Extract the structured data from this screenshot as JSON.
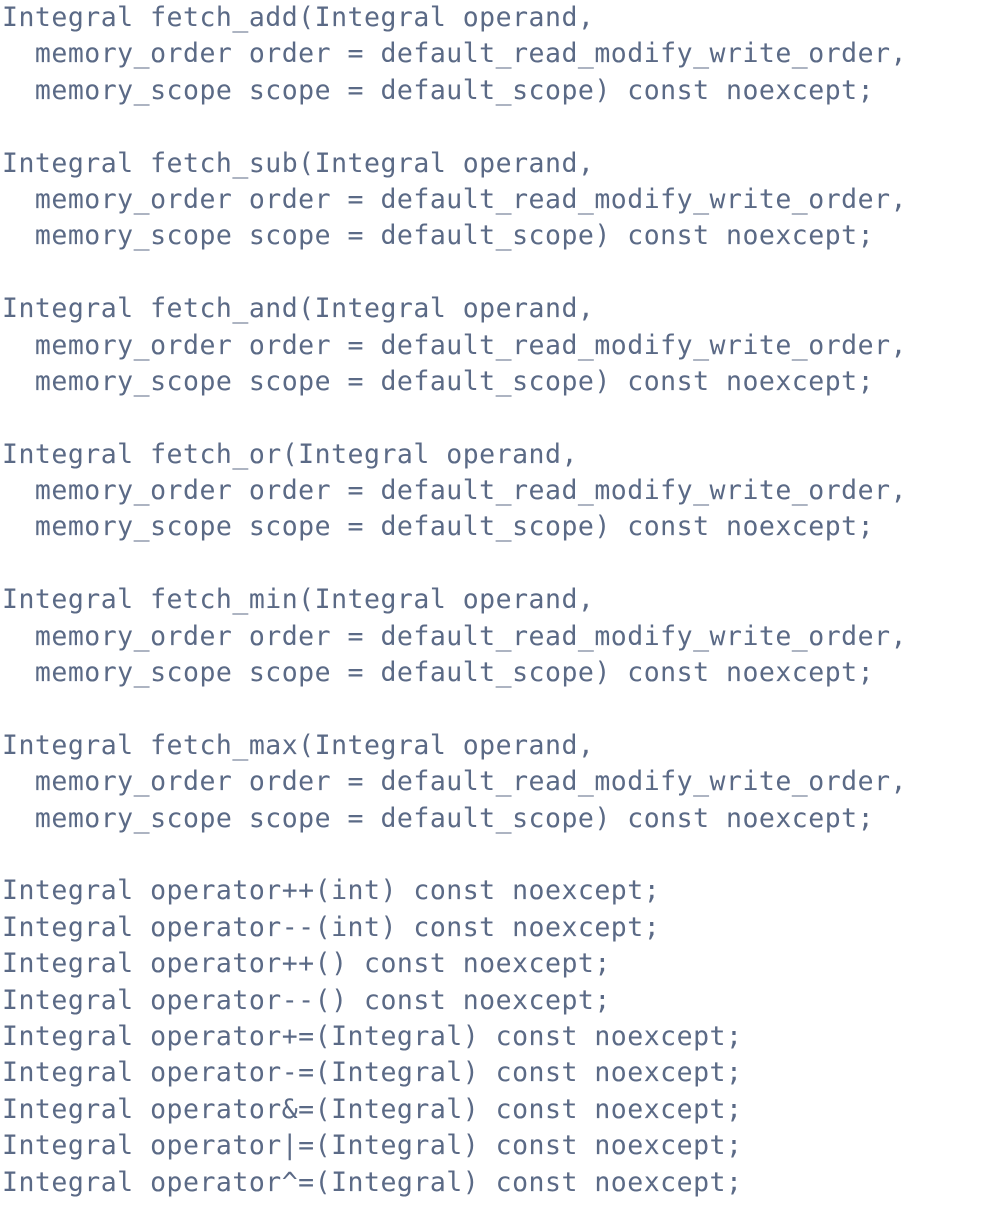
{
  "declarations": [
    {
      "lines": [
        "Integral fetch_add(Integral operand,",
        "  memory_order order = default_read_modify_write_order,",
        "  memory_scope scope = default_scope) const noexcept;"
      ]
    },
    {
      "lines": [
        "Integral fetch_sub(Integral operand,",
        "  memory_order order = default_read_modify_write_order,",
        "  memory_scope scope = default_scope) const noexcept;"
      ]
    },
    {
      "lines": [
        "Integral fetch_and(Integral operand,",
        "  memory_order order = default_read_modify_write_order,",
        "  memory_scope scope = default_scope) const noexcept;"
      ]
    },
    {
      "lines": [
        "Integral fetch_or(Integral operand,",
        "  memory_order order = default_read_modify_write_order,",
        "  memory_scope scope = default_scope) const noexcept;"
      ]
    },
    {
      "lines": [
        "Integral fetch_min(Integral operand,",
        "  memory_order order = default_read_modify_write_order,",
        "  memory_scope scope = default_scope) const noexcept;"
      ]
    },
    {
      "lines": [
        "Integral fetch_max(Integral operand,",
        "  memory_order order = default_read_modify_write_order,",
        "  memory_scope scope = default_scope) const noexcept;"
      ]
    }
  ],
  "operators": [
    "Integral operator++(int) const noexcept;",
    "Integral operator--(int) const noexcept;",
    "Integral operator++() const noexcept;",
    "Integral operator--() const noexcept;",
    "Integral operator+=(Integral) const noexcept;",
    "Integral operator-=(Integral) const noexcept;",
    "Integral operator&=(Integral) const noexcept;",
    "Integral operator|=(Integral) const noexcept;",
    "Integral operator^=(Integral) const noexcept;"
  ],
  "colors": {
    "text": "#5b6a86",
    "dark_text": "#2e3a52",
    "background": "#ffffff"
  }
}
